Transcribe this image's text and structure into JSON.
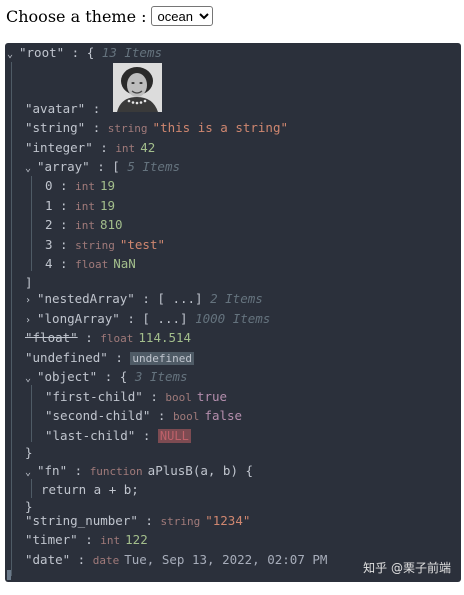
{
  "theme": {
    "label": "Choose a theme :",
    "selected": "ocean"
  },
  "root": {
    "key": "\"root\"",
    "open": "{",
    "count": "13 Items"
  },
  "rows": {
    "avatar": {
      "key": "\"avatar\""
    },
    "string": {
      "key": "\"string\"",
      "type": "string",
      "value": "\"this is a string\""
    },
    "integer": {
      "key": "\"integer\"",
      "type": "int",
      "value": "42"
    },
    "array": {
      "key": "\"array\"",
      "open": "[",
      "count": "5 Items",
      "close": "]",
      "items": [
        {
          "idx": "0",
          "type": "int",
          "value": "19"
        },
        {
          "idx": "1",
          "type": "int",
          "value": "19"
        },
        {
          "idx": "2",
          "type": "int",
          "value": "810"
        },
        {
          "idx": "3",
          "type": "string",
          "value": "\"test\""
        },
        {
          "idx": "4",
          "type": "float",
          "value": "NaN"
        }
      ]
    },
    "nestedArray": {
      "key": "\"nestedArray\"",
      "collapsed": "[ ...]",
      "count": "2 Items"
    },
    "longArray": {
      "key": "\"longArray\"",
      "collapsed": "[ ...]",
      "count": "1000 Items"
    },
    "float": {
      "key": "\"float\"",
      "type": "float",
      "value": "114.514"
    },
    "undefined": {
      "key": "\"undefined\"",
      "value": "undefined"
    },
    "object": {
      "key": "\"object\"",
      "open": "{",
      "count": "3 Items",
      "close": "}",
      "children": [
        {
          "key": "\"first-child\"",
          "type": "bool",
          "value": "true"
        },
        {
          "key": "\"second-child\"",
          "type": "bool",
          "value": "false"
        },
        {
          "key": "\"last-child\"",
          "value": "NULL"
        }
      ]
    },
    "fn": {
      "key": "\"fn\"",
      "type": "function",
      "signature": "aPlusB(a, b) {",
      "body": "return a + b;",
      "close": "}"
    },
    "string_number": {
      "key": "\"string_number\"",
      "type": "string",
      "value": "\"1234\""
    },
    "timer": {
      "key": "\"timer\"",
      "type": "int",
      "value": "122"
    },
    "date": {
      "key": "\"date\"",
      "type": "date",
      "value": "Tue, Sep 13, 2022, 02:07 PM"
    }
  },
  "watermark": "知乎 @栗子前端",
  "colors": {
    "background": "#2b303b",
    "string": "#d08770",
    "number": "#a3be8c",
    "bool": "#b48ead",
    "null": "#bf616a"
  }
}
